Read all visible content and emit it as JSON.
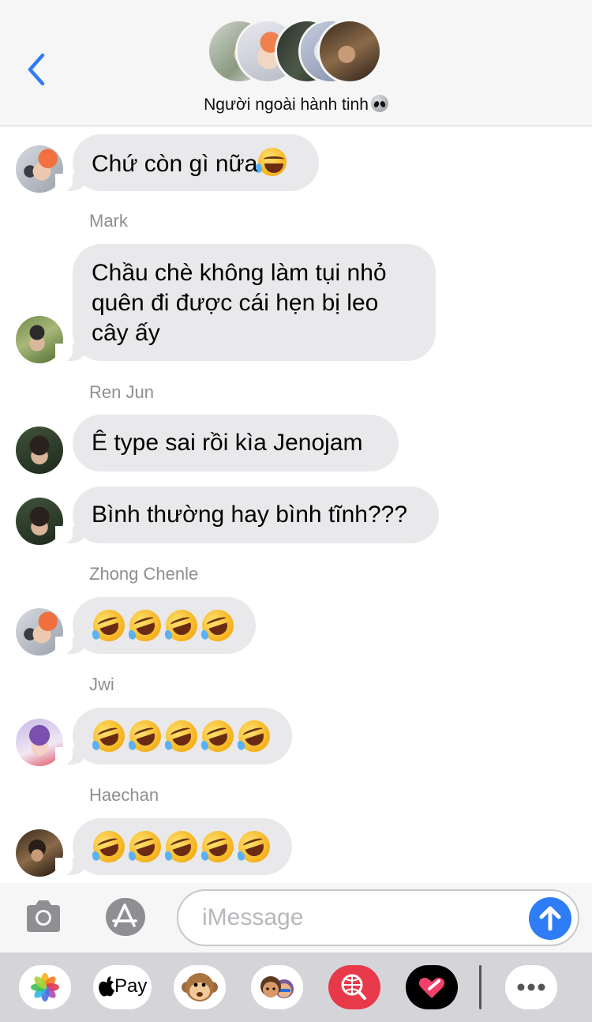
{
  "header": {
    "back_label": "<",
    "group_name": "Người ngoài hành tinh",
    "group_emoji": "alien-icon"
  },
  "messages": [
    {
      "sender": "",
      "text": "Chứ còn gì nữa",
      "emoji": "face-with-tears-of-joy",
      "avatar": "avatar-headphones"
    },
    {
      "sender": "Mark",
      "text_lines": [
        "Chầu chè không làm tụi nhỏ",
        "quên đi được cái hẹn bị leo",
        "cây ấy"
      ],
      "avatar": "avatar-mark"
    },
    {
      "sender": "Ren Jun",
      "text": "Ê type sai rồi kìa Jenojam",
      "avatar": "avatar-renjun"
    },
    {
      "sender": "",
      "text": "Bình thường hay bình tĩnh???",
      "avatar": "avatar-renjun"
    },
    {
      "sender": "Zhong Chenle",
      "emoji_count": 4,
      "emoji": "rolling-on-the-floor-laughing",
      "avatar": "avatar-headphones"
    },
    {
      "sender": "Jwi",
      "emoji_count": 5,
      "emoji": "rolling-on-the-floor-laughing",
      "avatar": "avatar-jwi"
    },
    {
      "sender": "Haechan",
      "emoji_count": 5,
      "emoji": "rolling-on-the-floor-laughing",
      "avatar": "avatar-haechan"
    }
  ],
  "input": {
    "placeholder": "iMessage",
    "value": ""
  },
  "apps": [
    {
      "name": "photos",
      "icon": "photos-icon"
    },
    {
      "name": "apple-pay",
      "label": "Pay",
      "icon": "apple-icon"
    },
    {
      "name": "animoji",
      "icon": "monkey-icon"
    },
    {
      "name": "memoji",
      "icon": "memoji-icon"
    },
    {
      "name": "search-images",
      "icon": "globe-search-icon"
    },
    {
      "name": "digital-touch",
      "icon": "heart-touch-icon"
    },
    {
      "name": "more",
      "icon": "ellipsis-icon"
    }
  ],
  "colors": {
    "accent": "#2e7cf6",
    "bubble": "#e9e9eb",
    "sender_label": "#8e8e93",
    "header_bg": "#f6f6f6"
  }
}
